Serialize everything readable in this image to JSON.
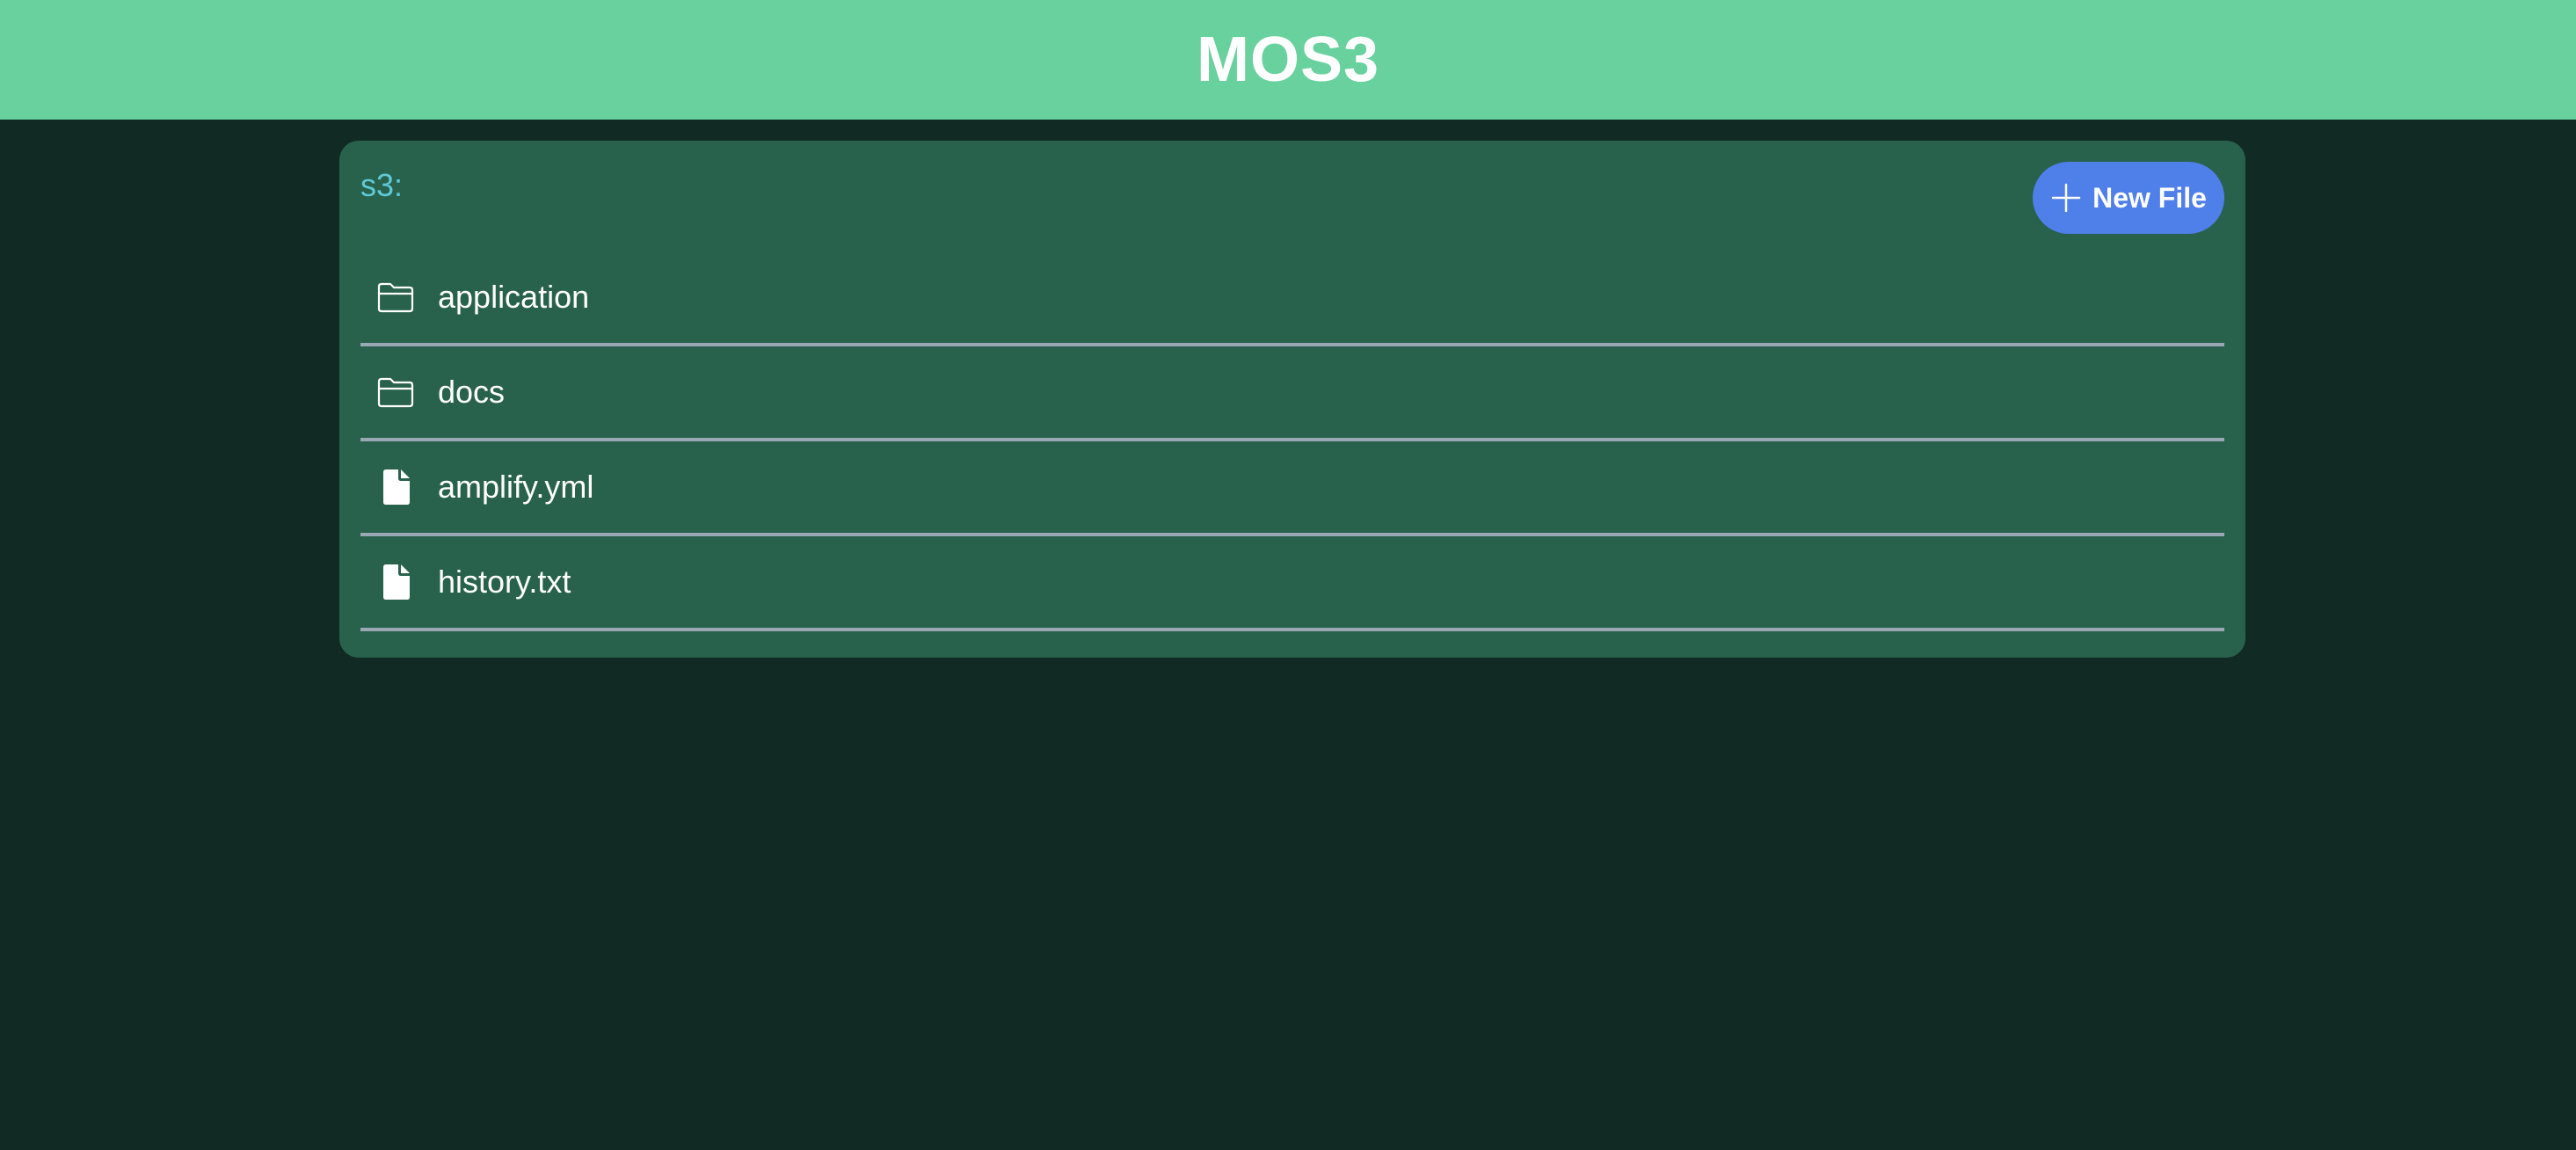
{
  "header": {
    "title": "MOS3"
  },
  "browser": {
    "path": "s3:",
    "new_file_label": "New File",
    "items": [
      {
        "name": "application",
        "type": "folder",
        "icon": "folder-icon"
      },
      {
        "name": "docs",
        "type": "folder",
        "icon": "folder-icon"
      },
      {
        "name": "amplify.yml",
        "type": "file",
        "icon": "file-icon"
      },
      {
        "name": "history.txt",
        "type": "file",
        "icon": "file-icon"
      }
    ]
  },
  "colors": {
    "background": "#112a23",
    "header": "#69d19e",
    "panel": "#29624c",
    "accent_button": "#4f7fe9",
    "path_text": "#5fc9d9",
    "divider": "#9aa7b4"
  }
}
